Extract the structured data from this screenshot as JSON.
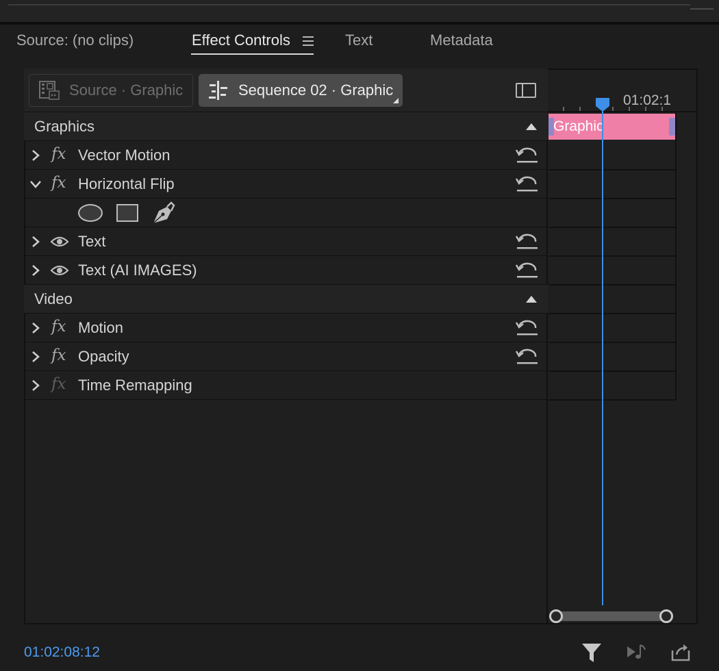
{
  "tabs": [
    {
      "label": "Source: (no clips)",
      "active": false
    },
    {
      "label": "Effect Controls",
      "active": true
    },
    {
      "label": "Text",
      "active": false
    },
    {
      "label": "Metadata",
      "active": false
    }
  ],
  "source_selector": {
    "source_label": "Source · Graphic",
    "sequence_label": "Sequence 02 · Graphic"
  },
  "sections": {
    "graphics": "Graphics",
    "video": "Video"
  },
  "effects": {
    "vector_motion": "Vector Motion",
    "horizontal_flip": "Horizontal Flip",
    "text_1": "Text",
    "text_2": "Text (AI IMAGES)",
    "motion": "Motion",
    "opacity": "Opacity",
    "time_remapping": "Time Remapping"
  },
  "fx_glyph": "fx",
  "timeline": {
    "ruler_time": "01:02:1",
    "clip_label": "Graphic",
    "clip_color": "#ef7fa7",
    "playhead_color": "#3d8fe8"
  },
  "footer": {
    "timecode": "01:02:08:12"
  },
  "icons": {
    "filter": "filter-icon",
    "play_audio": "play-audio-icon",
    "export": "export-icon"
  }
}
